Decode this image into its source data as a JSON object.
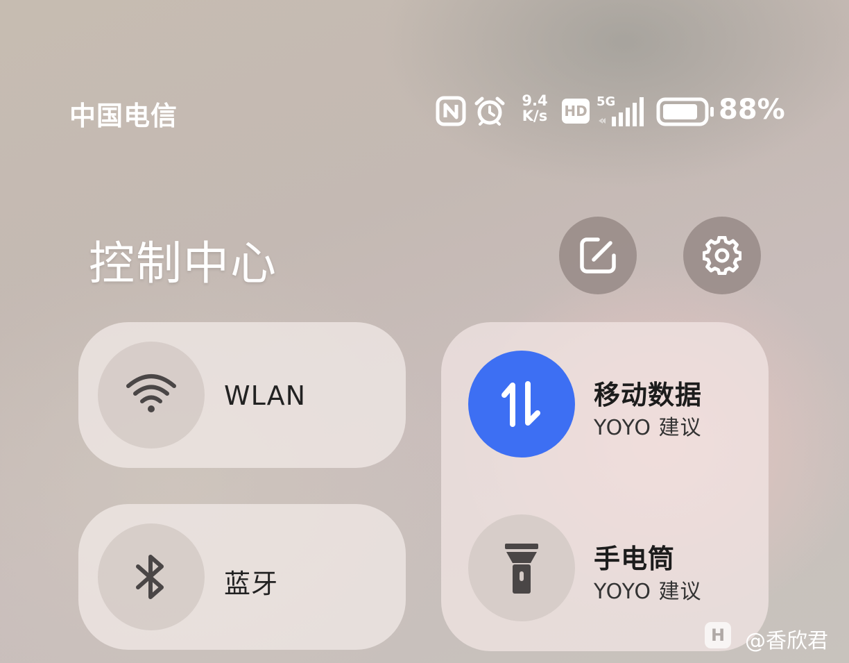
{
  "status_bar": {
    "carrier": "中国电信",
    "net_speed_value": "9.4",
    "net_speed_unit": "K/s",
    "hd_label": "HD",
    "network_type": "5G",
    "battery_percent": "88%",
    "battery_level": 0.88,
    "icons": [
      "nfc-icon",
      "alarm-icon",
      "hd-icon",
      "signal-icon",
      "battery-icon"
    ]
  },
  "header": {
    "title": "控制中心",
    "edit_icon": "edit-icon",
    "settings_icon": "gear-icon"
  },
  "tiles": {
    "wlan": {
      "label": "WLAN",
      "icon": "wifi-icon"
    },
    "bluetooth": {
      "label": "蓝牙",
      "icon": "bluetooth-icon"
    },
    "mobile_data": {
      "title": "移动数据",
      "subtitle": "YOYO 建议",
      "icon": "data-arrows-icon",
      "accent": "#3d6ff3"
    },
    "flashlight": {
      "title": "手电筒",
      "subtitle": "YOYO 建议",
      "icon": "flashlight-icon"
    }
  },
  "watermark": {
    "badge": "H",
    "text": "@香欣君"
  }
}
